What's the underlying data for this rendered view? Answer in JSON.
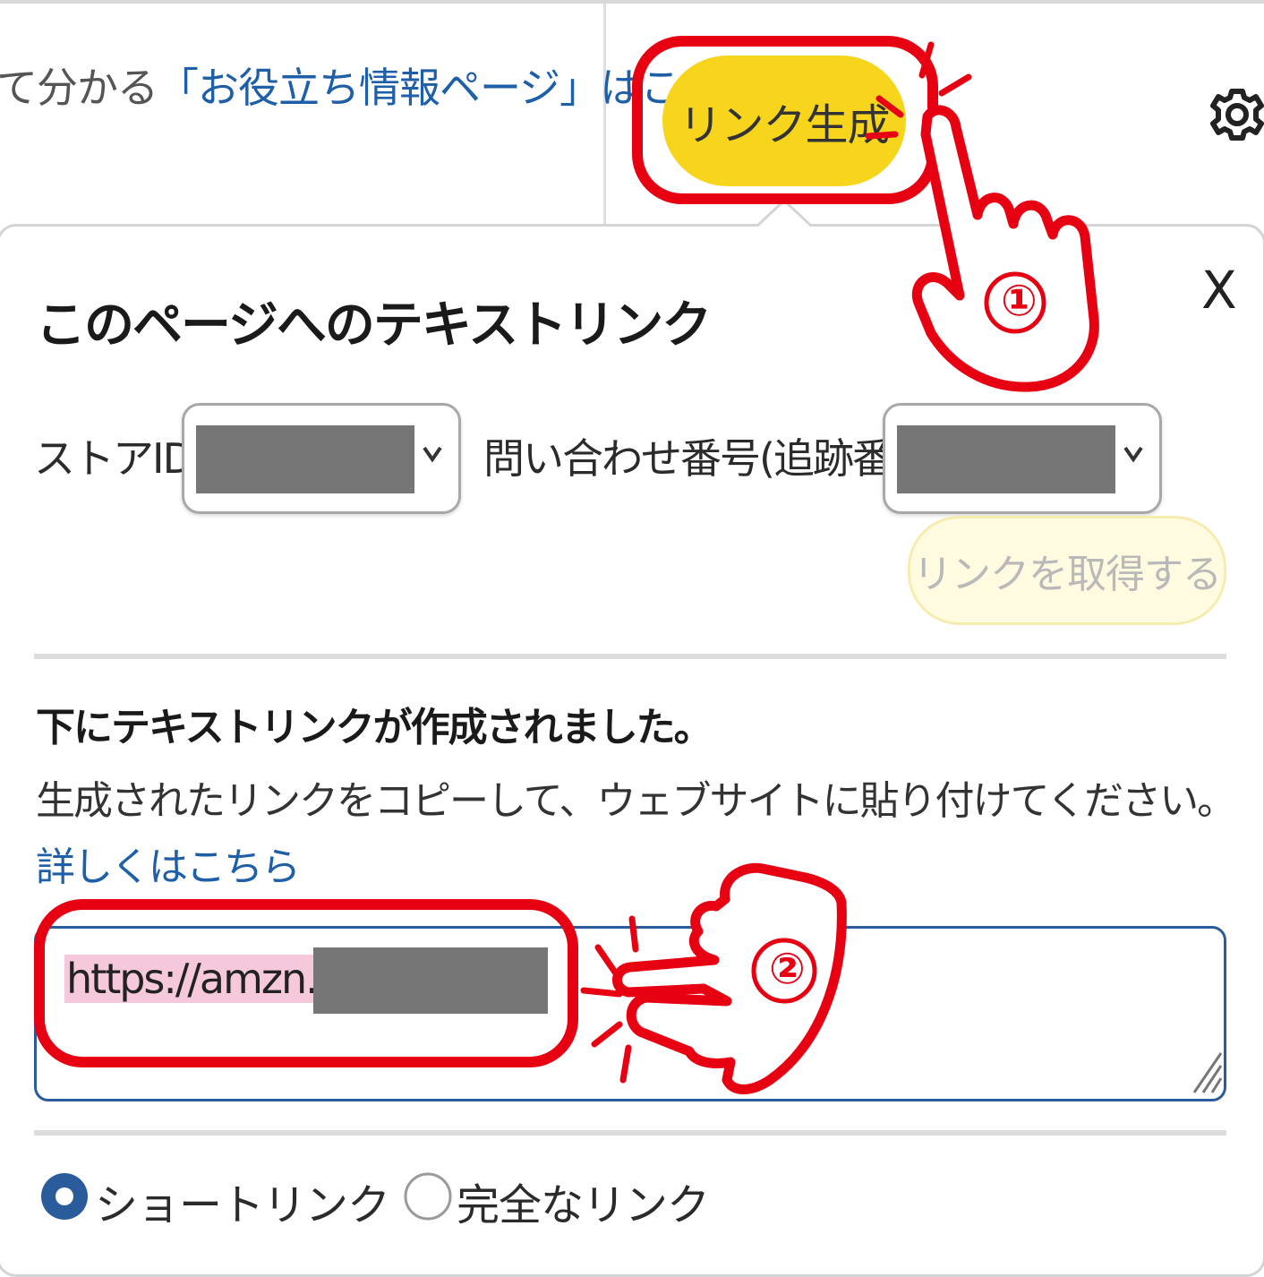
{
  "header": {
    "partial_text_plain": "て分かる",
    "partial_text_link": "「お役立ち情報ページ」はこ",
    "generate_button_label": "リンク生成",
    "settings_icon": "gear-icon"
  },
  "popover": {
    "title": "このページへのテキストリンク",
    "close_label": "X",
    "store_id_label": "ストアID:",
    "tracking_id_label": "問い合わせ番号(追跡番号):",
    "get_link_button_label": "リンクを取得する",
    "result_heading": "下にテキストリンクが作成されました。",
    "result_instruction": "生成されたリンクをコピーして、ウェブサイトに貼り付けてください。",
    "details_link_label": "詳しくはこちら",
    "link_text_value": "https://amzn.to",
    "link_type_options": [
      {
        "label": "ショートリンク",
        "selected": true
      },
      {
        "label": "完全なリンク",
        "selected": false
      }
    ]
  },
  "annotations": {
    "step_1": "①",
    "step_2": "②",
    "highlight_color": "#e60012"
  },
  "colors": {
    "generate_button": "#f7d51d",
    "link_blue": "#1f5fa8",
    "radio_selected": "#2a5c9c"
  }
}
